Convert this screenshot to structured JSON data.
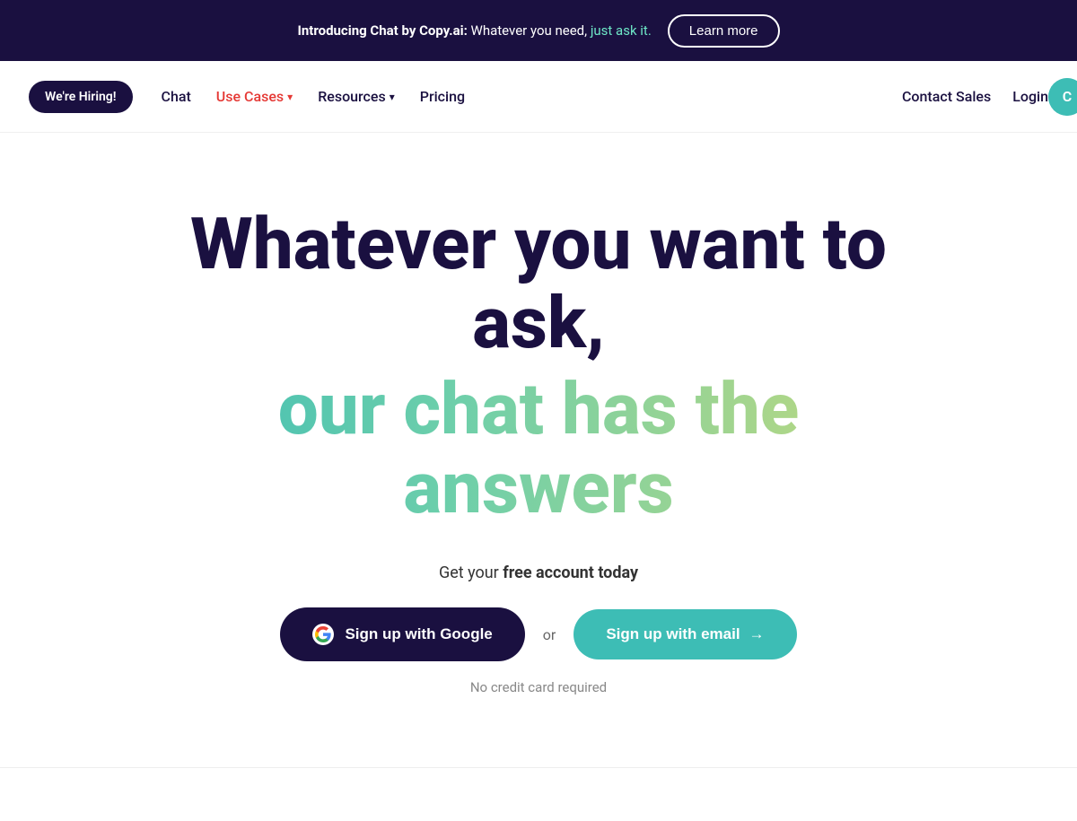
{
  "banner": {
    "text_bold": "Introducing Chat by Copy.ai:",
    "text_normal": " Whatever you need,",
    "text_highlight": " just ask it.",
    "learn_more_label": "Learn more"
  },
  "navbar": {
    "hiring_label": "We're Hiring!",
    "links": [
      {
        "label": "Chat",
        "type": "normal"
      },
      {
        "label": "Use Cases",
        "type": "red-arrow"
      },
      {
        "label": "Resources",
        "type": "arrow"
      },
      {
        "label": "Pricing",
        "type": "normal"
      }
    ],
    "contact_sales_label": "Contact Sales",
    "login_label": "Login"
  },
  "hero": {
    "title_line1": "Whatever you want to ask,",
    "title_line2": "our chat has the answers",
    "cta_text_normal": "Get your ",
    "cta_text_bold": "free account today",
    "google_btn_label": "Sign up with Google",
    "or_text": "or",
    "email_btn_label": "Sign up with email",
    "no_credit_label": "No credit card required"
  }
}
